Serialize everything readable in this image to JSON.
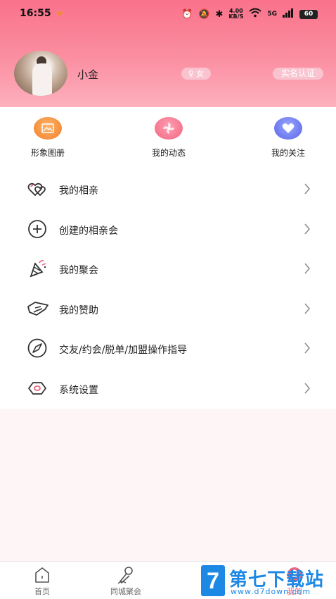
{
  "status_bar": {
    "time": "16:55",
    "net_speed_value": "4.00",
    "net_speed_unit": "KB/S",
    "network": "5G",
    "battery": "60"
  },
  "profile": {
    "name": "小金",
    "gender_label": "女",
    "verify_label": "实名认证"
  },
  "quick_actions": [
    {
      "label": "形象图册",
      "icon": "photo-album-icon",
      "color": "#f07e28"
    },
    {
      "label": "我的动态",
      "icon": "pinwheel-icon",
      "color": "#f0657f"
    },
    {
      "label": "我的关注",
      "icon": "heart-icon",
      "color": "#5a64e8"
    }
  ],
  "menu": [
    {
      "label": "我的相亲",
      "icon": "double-heart-icon"
    },
    {
      "label": "创建的相亲会",
      "icon": "plus-circle-icon"
    },
    {
      "label": "我的聚会",
      "icon": "party-popper-icon"
    },
    {
      "label": "我的赞助",
      "icon": "handshake-icon"
    },
    {
      "label": "交友/约会/脱单/加盟操作指导",
      "icon": "compass-icon"
    },
    {
      "label": "系统设置",
      "icon": "hexagon-settings-icon"
    }
  ],
  "tabbar": [
    {
      "label": "首页",
      "icon": "home-icon"
    },
    {
      "label": "同城聚会",
      "icon": "microphone-icon"
    },
    {
      "label": "我的",
      "icon": "profile-icon",
      "active": true
    }
  ],
  "watermark": {
    "logo": "7",
    "title": "第七下载站",
    "url": "www.d7down.com"
  },
  "colors": {
    "header_top": "#f9728b",
    "accent_pink": "#f0657f",
    "badge_bg": "#f9c3cf"
  }
}
